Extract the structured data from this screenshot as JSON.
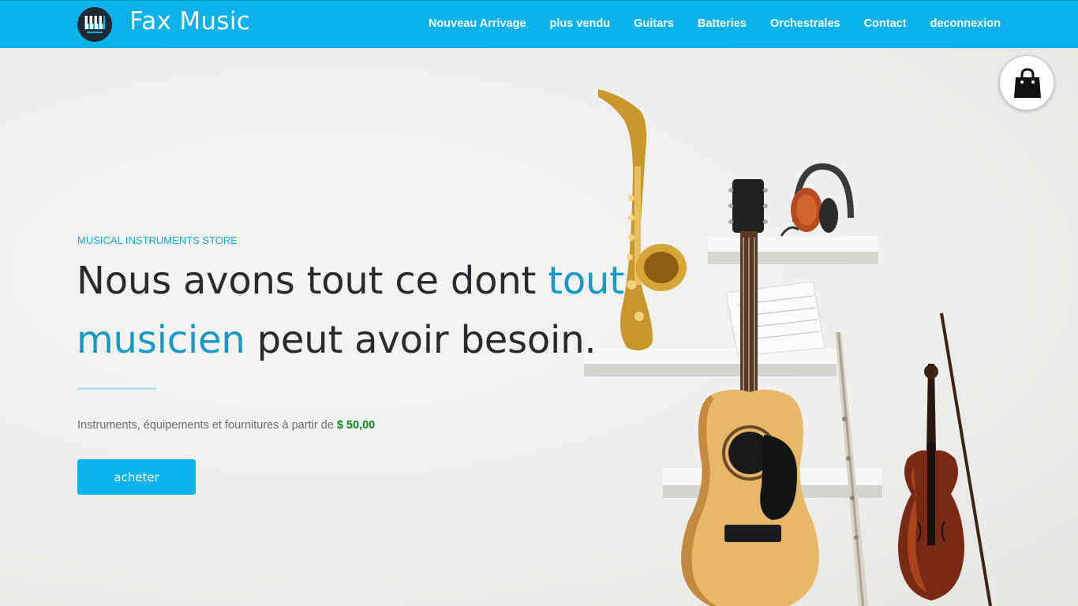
{
  "brand": {
    "name": "Fax Music",
    "logo_icon": "piano-keys-logo-icon"
  },
  "nav": {
    "items": [
      {
        "label": "Nouveau Arrivage"
      },
      {
        "label": "plus vendu"
      },
      {
        "label": "Guitars"
      },
      {
        "label": "Batteries"
      },
      {
        "label": "Orchestrales"
      },
      {
        "label": "Contact"
      },
      {
        "label": "deconnexion"
      }
    ]
  },
  "hero": {
    "eyebrow": "MUSICAL INSTRUMENTS STORE",
    "headline_part1": "Nous avons tout ce dont ",
    "headline_highlight": "tout musicien",
    "headline_part2": " peut avoir besoin.",
    "subtext": "Instruments, équipements et fournitures à partir de ",
    "price": "$ 50,00",
    "button_label": "acheter"
  },
  "cart": {
    "icon": "shopping-bag-icon"
  },
  "colors": {
    "header_bg": "#0ab2ea",
    "accent_text": "#1799c8",
    "price": "#0d8a1f",
    "headline": "#2a2a2e",
    "button_bg": "#0ab2ea"
  }
}
